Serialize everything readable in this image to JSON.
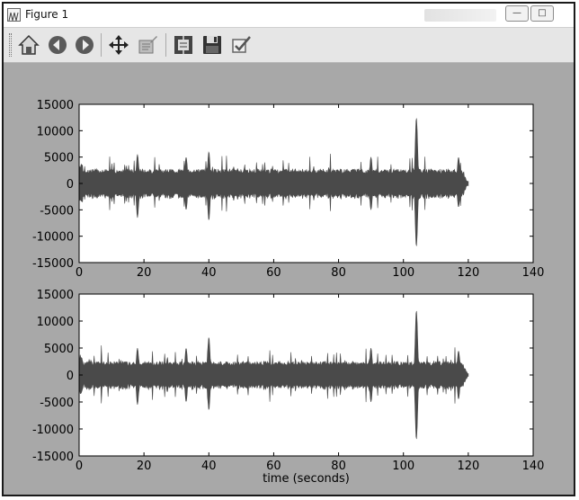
{
  "window": {
    "title": "Figure 1"
  },
  "toolbar": {
    "buttons": [
      {
        "name": "home",
        "icon": "home-icon"
      },
      {
        "name": "back",
        "icon": "back-arrow-icon"
      },
      {
        "name": "forward",
        "icon": "forward-arrow-icon"
      },
      {
        "name": "pan",
        "icon": "move-arrows-icon"
      },
      {
        "name": "zoom",
        "icon": "zoom-rect-icon"
      },
      {
        "name": "subplots",
        "icon": "subplots-config-icon"
      },
      {
        "name": "save",
        "icon": "floppy-disk-icon"
      },
      {
        "name": "edit",
        "icon": "edit-checkbox-icon"
      }
    ]
  },
  "colors": {
    "signal": "#4a4a4a",
    "figure_bg": "#a8a8a8",
    "axes_bg": "#ffffff"
  },
  "chart_data": [
    {
      "type": "line",
      "xlabel": "",
      "ylabel": "",
      "xlim": [
        0,
        140
      ],
      "ylim": [
        -15000,
        15000
      ],
      "xticks": [
        "0",
        "20",
        "40",
        "60",
        "80",
        "100",
        "120",
        "140"
      ],
      "yticks": [
        "15000",
        "10000",
        "5000",
        "0",
        "-5000",
        "-10000",
        "-15000"
      ],
      "signal_range_x": [
        0,
        120
      ],
      "base_amplitude": 2500,
      "peaks": [
        {
          "x": 104,
          "max": 12500,
          "min": -12000
        },
        {
          "x": 40,
          "max": 6000,
          "min": -7000
        },
        {
          "x": 33,
          "max": 5000,
          "min": -5000
        },
        {
          "x": 18,
          "max": 5500,
          "min": -6500
        },
        {
          "x": 90,
          "max": 5000,
          "min": -5000
        },
        {
          "x": 117,
          "max": 5000,
          "min": -4500
        }
      ]
    },
    {
      "type": "line",
      "xlabel": "time (seconds)",
      "ylabel": "",
      "xlim": [
        0,
        140
      ],
      "ylim": [
        -15000,
        15000
      ],
      "xticks": [
        "0",
        "20",
        "40",
        "60",
        "80",
        "100",
        "120",
        "140"
      ],
      "yticks": [
        "15000",
        "10000",
        "5000",
        "0",
        "-5000",
        "-10000",
        "-15000"
      ],
      "signal_range_x": [
        0,
        120
      ],
      "base_amplitude": 2300,
      "peaks": [
        {
          "x": 104,
          "max": 12000,
          "min": -12000
        },
        {
          "x": 40,
          "max": 7000,
          "min": -6500
        },
        {
          "x": 33,
          "max": 5000,
          "min": -5000
        },
        {
          "x": 18,
          "max": 5000,
          "min": -5500
        },
        {
          "x": 90,
          "max": 5000,
          "min": -5000
        },
        {
          "x": 117,
          "max": 4500,
          "min": -4500
        }
      ]
    }
  ]
}
